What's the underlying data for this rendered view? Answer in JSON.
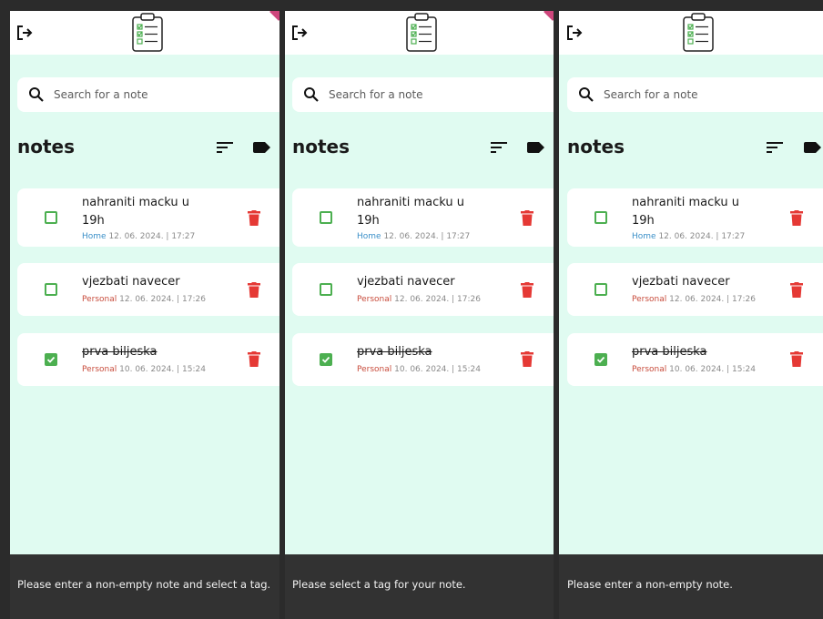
{
  "screens": [
    {
      "search": {
        "placeholder": "Search for a note"
      },
      "notes_title": "notes",
      "notes": [
        {
          "title_line1": "nahraniti macku u",
          "title_line2": "19h",
          "tag": "Home",
          "date": "12. 06. 2024. | 17:27",
          "done": false
        },
        {
          "title_line1": "vjezbati navecer",
          "title_line2": "",
          "tag": "Personal",
          "date": "12. 06. 2024. | 17:26",
          "done": false
        },
        {
          "title_line1": "prva biljeska",
          "title_line2": "",
          "tag": "Personal",
          "date": "10. 06. 2024. | 15:24",
          "done": true
        }
      ],
      "snackbar": "Please enter a non-empty note and select a tag."
    },
    {
      "search": {
        "placeholder": "Search for a note"
      },
      "notes_title": "notes",
      "notes": [
        {
          "title_line1": "nahraniti macku u",
          "title_line2": "19h",
          "tag": "Home",
          "date": "12. 06. 2024. | 17:27",
          "done": false
        },
        {
          "title_line1": "vjezbati navecer",
          "title_line2": "",
          "tag": "Personal",
          "date": "12. 06. 2024. | 17:26",
          "done": false
        },
        {
          "title_line1": "prva biljeska",
          "title_line2": "",
          "tag": "Personal",
          "date": "10. 06. 2024. | 15:24",
          "done": true
        }
      ],
      "snackbar": "Please select a tag for your note."
    },
    {
      "search": {
        "placeholder": "Search for a note"
      },
      "notes_title": "notes",
      "notes": [
        {
          "title_line1": "nahraniti macku u",
          "title_line2": "19h",
          "tag": "Home",
          "date": "12. 06. 2024. | 17:27",
          "done": false
        },
        {
          "title_line1": "vjezbati navecer",
          "title_line2": "",
          "tag": "Personal",
          "date": "12. 06. 2024. | 17:26",
          "done": false
        },
        {
          "title_line1": "prva biljeska",
          "title_line2": "",
          "tag": "Personal",
          "date": "10. 06. 2024. | 15:24",
          "done": true
        }
      ],
      "snackbar": "Please enter a non-empty note."
    }
  ],
  "colors": {
    "background": "#e0fbf1",
    "checkbox_green": "#4caf50",
    "delete_red": "#e53935",
    "tag_home": "#3a8fc8",
    "tag_personal": "#c84c3c",
    "snackbar": "#323232"
  },
  "icons": {
    "logout": "logout-icon",
    "logo": "clipboard-checklist-icon",
    "search": "search-icon",
    "sort": "sort-icon",
    "tag": "label-icon",
    "delete": "trash-icon",
    "check": "check-icon"
  }
}
